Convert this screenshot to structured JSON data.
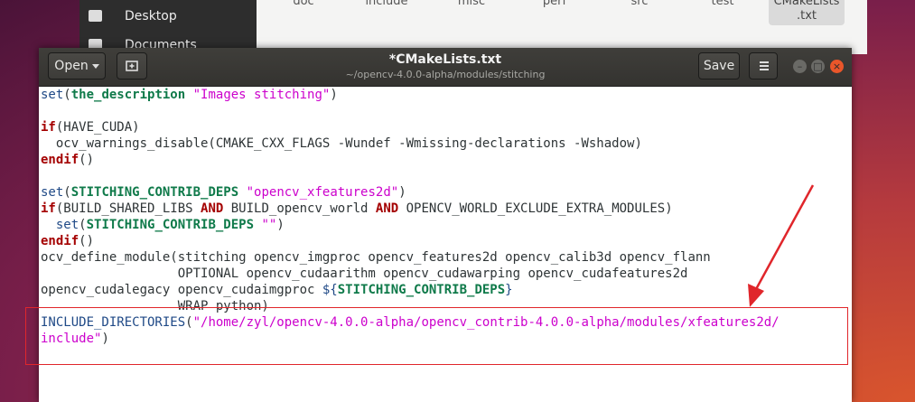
{
  "file_manager": {
    "sidebar": [
      {
        "label": "Desktop",
        "icon": "folder-icon"
      },
      {
        "label": "Documents",
        "icon": "folder-icon"
      }
    ],
    "folders": [
      "doc",
      "include",
      "misc",
      "perf",
      "src",
      "test"
    ],
    "selected_file": {
      "line1": "CMakeLists",
      "line2": ".txt"
    }
  },
  "editor": {
    "open_label": "Open",
    "title": "*CMakeLists.txt",
    "subtitle": "~/opencv-4.0.0-alpha/modules/stitching",
    "save_label": "Save"
  },
  "code": {
    "l1": [
      "set",
      "(",
      "the_description",
      " ",
      "\"Images stitching\"",
      ")"
    ],
    "l3": [
      "if",
      "(HAVE_CUDA)"
    ],
    "l4": [
      "  ocv_warnings_disable(CMAKE_CXX_FLAGS -Wundef -Wmissing-declarations -Wshadow)"
    ],
    "l5": [
      "endif",
      "()"
    ],
    "l7": [
      "set",
      "(",
      "STITCHING_CONTRIB_DEPS",
      " ",
      "\"opencv_xfeatures2d\"",
      ")"
    ],
    "l8": [
      "if",
      "(BUILD_SHARED_LIBS ",
      "AND",
      " BUILD_opencv_world ",
      "AND",
      " OPENCV_WORLD_EXCLUDE_EXTRA_MODULES)"
    ],
    "l9": [
      "  ",
      "set",
      "(",
      "STITCHING_CONTRIB_DEPS",
      " ",
      "\"\"",
      ")"
    ],
    "l10": [
      "endif",
      "()"
    ],
    "l11": [
      "ocv_define_module(stitching opencv_imgproc opencv_features2d opencv_calib3d opencv_flann"
    ],
    "l12": [
      "                  OPTIONAL opencv_cudaarithm opencv_cudawarping opencv_cudafeatures2d"
    ],
    "l13": [
      "opencv_cudalegacy opencv_cudaimgproc ",
      "${",
      "STITCHING_CONTRIB_DEPS",
      "}"
    ],
    "l14": [
      "                  WRAP python)"
    ],
    "l15": [
      "INCLUDE_DIRECTORIES",
      "(",
      "\"/home/zyl/opencv-4.0.0-alpha/opencv_contrib-4.0.0-alpha/modules/xfeatures2d/"
    ],
    "l16": [
      "include\"",
      ")"
    ]
  },
  "annotation": {
    "color": "#e0262b"
  },
  "colors": {
    "close": "#e9562a",
    "headerbar": "#3a3936"
  }
}
